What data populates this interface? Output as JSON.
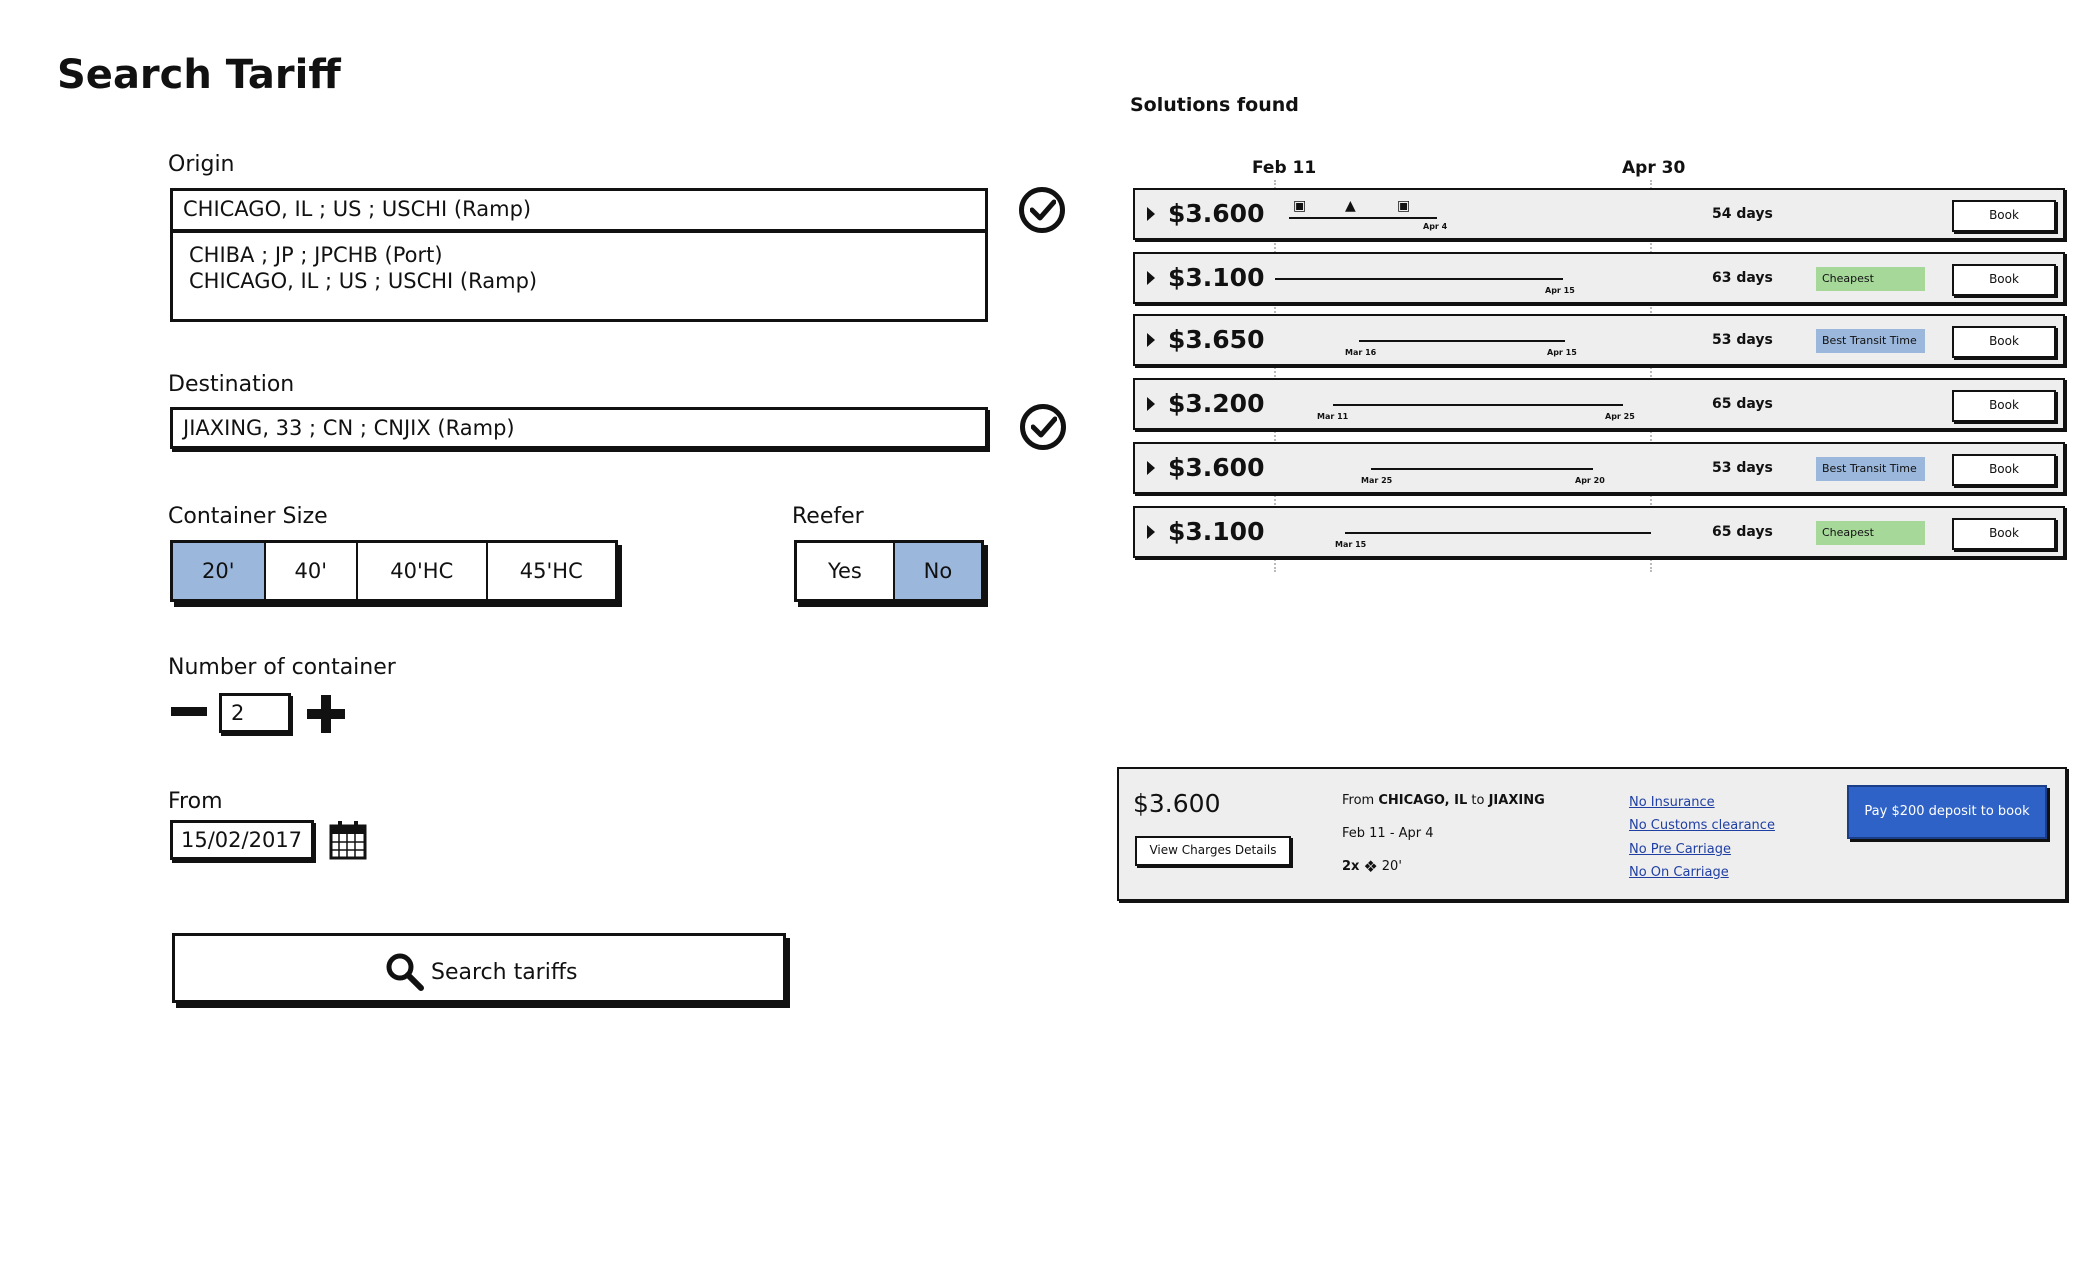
{
  "page": {
    "title": "Search Tariff"
  },
  "form": {
    "origin": {
      "label": "Origin",
      "value": "CHICAGO, IL ; US ; USCHI (Ramp)",
      "suggestions": [
        "CHIBA ; JP ; JPCHB (Port)",
        "CHICAGO, IL ; US ; USCHI (Ramp)"
      ]
    },
    "destination": {
      "label": "Destination",
      "value": "JIAXING, 33 ; CN ; CNJIX (Ramp)"
    },
    "container_size": {
      "label": "Container Size",
      "options": [
        "20'",
        "40'",
        "40'HC",
        "45'HC"
      ],
      "selected": "20'"
    },
    "reefer": {
      "label": "Reefer",
      "options": [
        "Yes",
        "No"
      ],
      "selected": "No"
    },
    "number_of_container": {
      "label": "Number of container",
      "value": "2"
    },
    "from": {
      "label": "From",
      "value": "15/02/2017"
    },
    "search_button": {
      "label": "Search tariffs"
    }
  },
  "solutions": {
    "heading": "Solutions found",
    "timeline_start": "Feb 11",
    "timeline_end": "Apr 30",
    "rows": [
      {
        "price": "$3.600",
        "days": "54 days",
        "tag": "",
        "tag_color": "",
        "book": "Book",
        "dates": [
          "Apr 4"
        ]
      },
      {
        "price": "$3.100",
        "days": "63 days",
        "tag": "Cheapest",
        "tag_color": "#a6d89a",
        "book": "Book",
        "dates": [
          "Apr 15"
        ]
      },
      {
        "price": "$3.650",
        "days": "53 days",
        "tag": "Best Transit Time",
        "tag_color": "#9bb7db",
        "book": "Book",
        "dates": [
          "Mar 16",
          "Apr 15"
        ]
      },
      {
        "price": "$3.200",
        "days": "65 days",
        "tag": "",
        "tag_color": "",
        "book": "Book",
        "dates": [
          "Mar 11",
          "Apr 25"
        ]
      },
      {
        "price": "$3.600",
        "days": "53 days",
        "tag": "Best Transit Time",
        "tag_color": "#9bb7db",
        "book": "Book",
        "dates": [
          "Mar 25",
          "Apr 20"
        ]
      },
      {
        "price": "$3.100",
        "days": "65 days",
        "tag": "Cheapest",
        "tag_color": "#a6d89a",
        "book": "Book",
        "dates": [
          "Mar 15"
        ]
      }
    ]
  },
  "summary": {
    "price": "$3.600",
    "view_charges": "View Charges Details",
    "route_prefix": "From",
    "route_origin": "CHICAGO, IL",
    "route_to": "to",
    "route_destination": "JIAXING",
    "dates": "Feb 11 - Apr 4",
    "qty": "2x",
    "size": "20'",
    "links": [
      "No Insurance",
      "No Customs clearance",
      "No Pre Carriage",
      "No On Carriage"
    ],
    "pay_button": "Pay $200 deposit to book"
  },
  "colors": {
    "selected": "#9bb7db",
    "cheapest": "#a6d89a",
    "primary": "#2f62c6",
    "link": "#1f3fa3"
  }
}
